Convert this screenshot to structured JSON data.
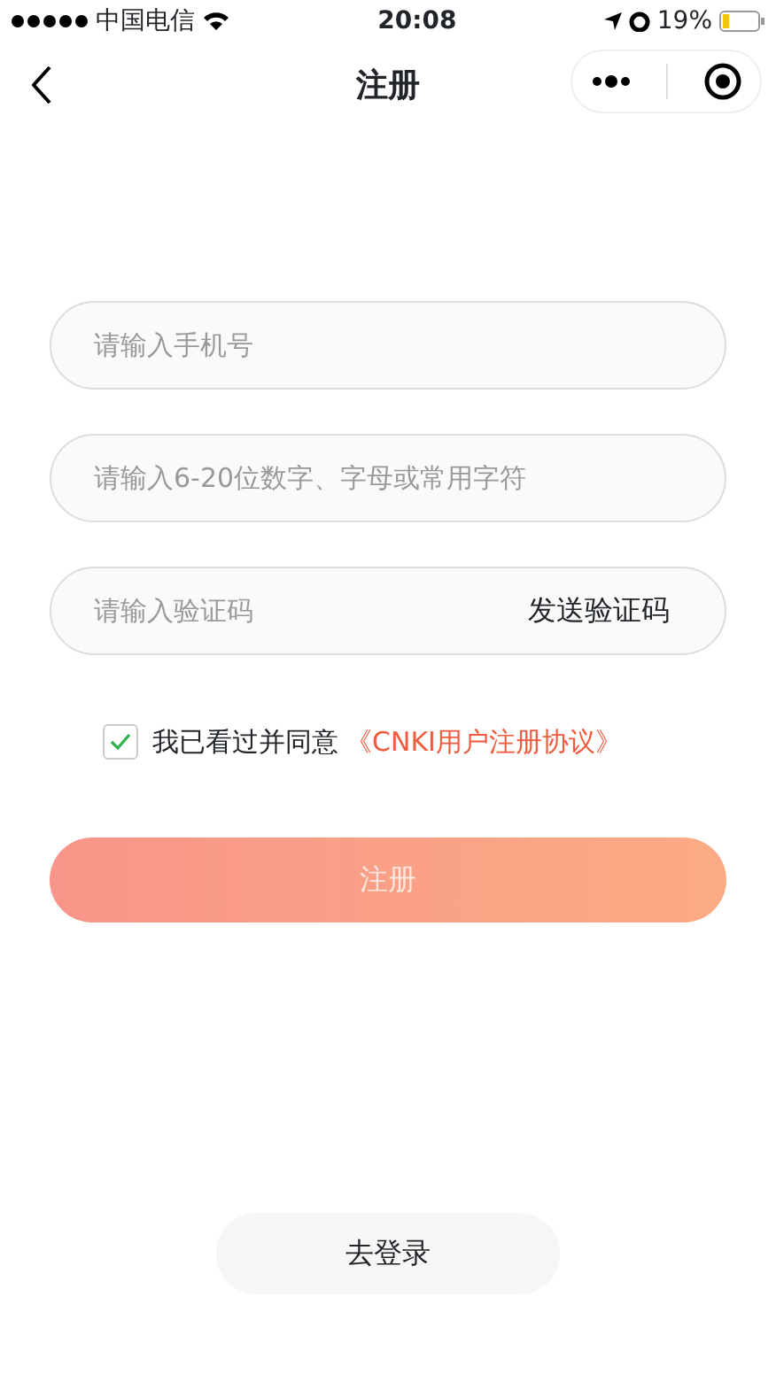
{
  "status_bar": {
    "carrier": "中国电信",
    "time": "20:08",
    "battery": "19%"
  },
  "nav": {
    "title": "注册"
  },
  "fields": [
    {
      "kind": "text",
      "placeholder": "请输入手机号"
    },
    {
      "kind": "text",
      "placeholder": "请输入6-20位数字、字母或常用字符"
    },
    {
      "kind": "code",
      "placeholder": "请输入验证码",
      "action": "发送验证码"
    }
  ],
  "agreement": {
    "checked": true,
    "text": "我已看过并同意",
    "link": "《CNKI用户注册协议》"
  },
  "submit": {
    "label": "注册",
    "disabled": true
  },
  "login": {
    "label": "去登录"
  }
}
